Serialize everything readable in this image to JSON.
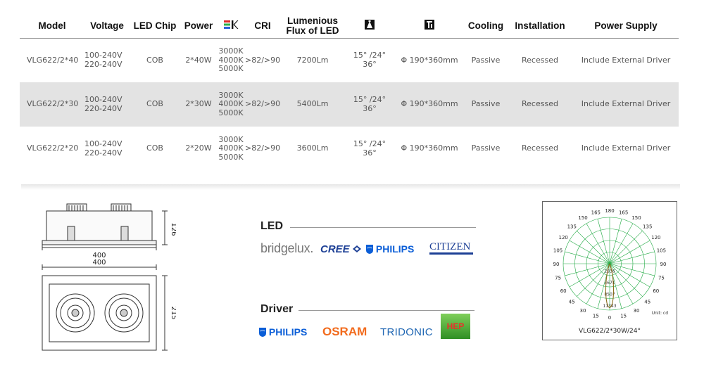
{
  "table": {
    "headers": {
      "model": "Model",
      "voltage": "Voltage",
      "led_chip": "LED Chip",
      "power": "Power",
      "cri": "CRI",
      "flux_line1": "Lumenious",
      "flux_line2": "Flux of LED",
      "cooling": "Cooling",
      "installation": "Installation",
      "power_supply": "Power Supply"
    },
    "header_icons": [
      "color-temperature-icon",
      "beam-angle-icon",
      "dimensions-icon"
    ],
    "rows": [
      {
        "model": "VLG622/2*40",
        "voltage_1": "100-240V",
        "voltage_2": "220-240V",
        "chip": "COB",
        "power": "2*40W",
        "cct_1": "3000K",
        "cct_2": "4000K",
        "cct_3": "5000K",
        "cri": ">82/>90",
        "flux": "7200Lm",
        "angle_1": "15° /24°",
        "angle_2": "36°",
        "size": "Φ 190*360mm",
        "cooling": "Passive",
        "installation": "Recessed",
        "supply": "Include External Driver"
      },
      {
        "model": "VLG622/2*30",
        "voltage_1": "100-240V",
        "voltage_2": "220-240V",
        "chip": "COB",
        "power": "2*30W",
        "cct_1": "3000K",
        "cct_2": "4000K",
        "cct_3": "5000K",
        "cri": ">82/>90",
        "flux": "5400Lm",
        "angle_1": "15° /24°",
        "angle_2": "36°",
        "size": "Φ 190*360mm",
        "cooling": "Passive",
        "installation": "Recessed",
        "supply": "Include External Driver"
      },
      {
        "model": "VLG622/2*20",
        "voltage_1": "100-240V",
        "voltage_2": "220-240V",
        "chip": "COB",
        "power": "2*20W",
        "cct_1": "3000K",
        "cct_2": "4000K",
        "cct_3": "5000K",
        "cri": ">82/>90",
        "flux": "3600Lm",
        "angle_1": "15° /24°",
        "angle_2": "36°",
        "size": "Φ 190*360mm",
        "cooling": "Passive",
        "installation": "Recessed",
        "supply": "Include External Driver"
      }
    ]
  },
  "drawing": {
    "dim_height": "126",
    "dim_width_top": "400",
    "dim_width_bottom": "400",
    "dim_depth": "215"
  },
  "brands": {
    "led_label": "LED",
    "driver_label": "Driver",
    "led_brands": {
      "bridgelux": "bridgelux.",
      "cree": "CREE",
      "philips": "PHILIPS",
      "citizen": "CITIZEN"
    },
    "driver_brands": {
      "philips": "PHILIPS",
      "osram": "OSRAM",
      "tridonic": "TRIDONIC",
      "hep": "HEP"
    },
    "colors": {
      "philips_blue": "#0b5ed7",
      "cree_blue": "#1c3f95",
      "osram_orange": "#f26b1d",
      "tridonic_blue": "#1f66b3",
      "hep_green": "#3f9d2e",
      "hep_text": "#e8322b"
    }
  },
  "polar": {
    "caption": "VLG622/2*30W/24°",
    "unit": "Unit: cd",
    "angle_labels": [
      "180",
      "165",
      "165",
      "150",
      "150",
      "135",
      "135",
      "120",
      "120",
      "105",
      "105",
      "90",
      "90",
      "75",
      "75",
      "60",
      "60",
      "45",
      "45",
      "30",
      "30",
      "15",
      "15",
      "0"
    ],
    "radial_labels": [
      "2836",
      "5671",
      "8507",
      "11343"
    ],
    "grid_color": "#22aa44",
    "curve_color": "#8a6d1c"
  }
}
